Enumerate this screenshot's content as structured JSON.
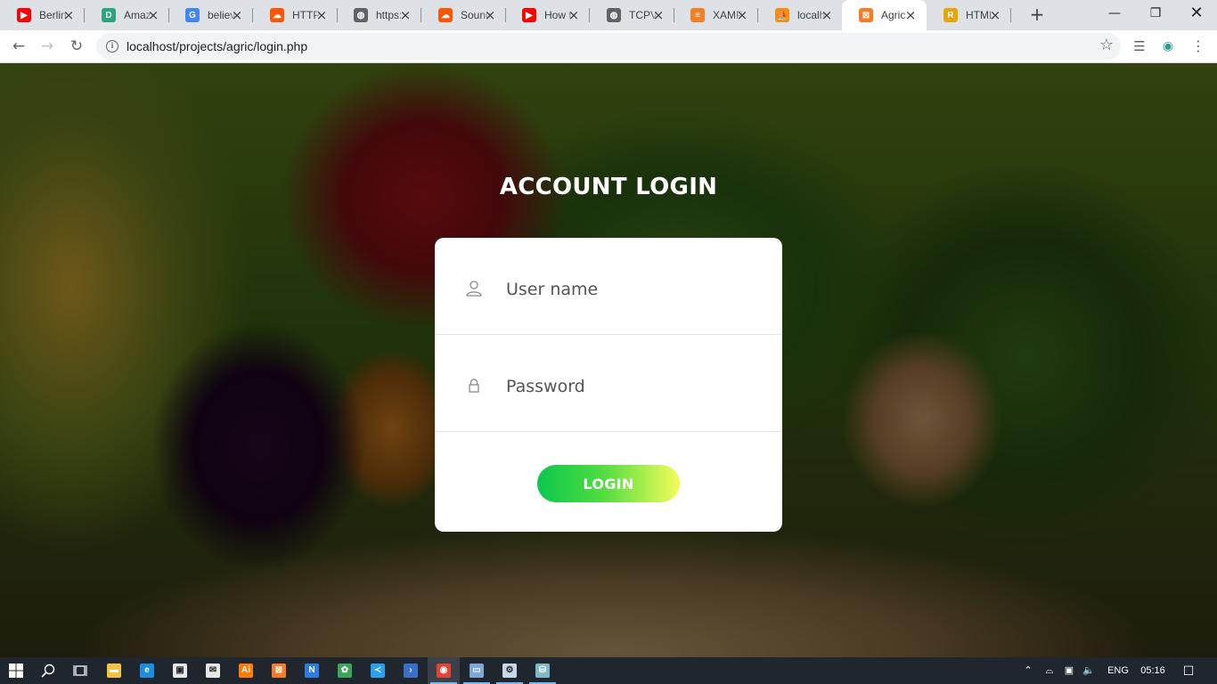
{
  "browser": {
    "tabs": [
      {
        "title": "Berlin",
        "icon": "youtube-icon",
        "color": "#ff0000",
        "glyph": "▶"
      },
      {
        "title": "Amazon",
        "icon": "d-letter-icon",
        "color": "#2aa67a",
        "glyph": "D"
      },
      {
        "title": "believe",
        "icon": "google-icon",
        "color": "#4285f4",
        "glyph": "G"
      },
      {
        "title": "HTTP",
        "icon": "soundcloud-icon",
        "color": "#ff5500",
        "glyph": "☁"
      },
      {
        "title": "https:",
        "icon": "globe-icon",
        "color": "#5f6368",
        "glyph": "◍"
      },
      {
        "title": "Sound",
        "icon": "soundcloud-icon",
        "color": "#ff5500",
        "glyph": "☁"
      },
      {
        "title": "How t",
        "icon": "youtube-icon",
        "color": "#ff0000",
        "glyph": "▶"
      },
      {
        "title": "TCPVi",
        "icon": "globe-icon",
        "color": "#5f6368",
        "glyph": "◍"
      },
      {
        "title": "XAMP",
        "icon": "stackoverflow-icon",
        "color": "#f48024",
        "glyph": "≡"
      },
      {
        "title": "localh",
        "icon": "phpmyadmin-icon",
        "color": "#f29111",
        "glyph": "⛵"
      },
      {
        "title": "Agric",
        "icon": "xampp-icon",
        "color": "#fb7a24",
        "glyph": "⊠",
        "active": true
      },
      {
        "title": "HTML",
        "icon": "r-letter-icon",
        "color": "#e8a400",
        "glyph": "R"
      }
    ],
    "address": "localhost/projects/agric/login.php"
  },
  "page": {
    "heading": "ACCOUNT LOGIN",
    "username_placeholder": "User name",
    "password_placeholder": "Password",
    "login_label": "LOGIN"
  },
  "colors": {
    "button_gradient_start": "#0bc74e",
    "button_gradient_end": "#f4fd5a",
    "taskbar": "#20262e"
  },
  "taskbar": {
    "apps": [
      {
        "name": "file-explorer-icon",
        "color": "#f5c23e",
        "glyph": "▬"
      },
      {
        "name": "edge-icon",
        "color": "#1a8ee0",
        "glyph": "e"
      },
      {
        "name": "store-icon",
        "color": "#e8e8e8",
        "glyph": "▣"
      },
      {
        "name": "mail-icon",
        "color": "#e8e8e8",
        "glyph": "✉"
      },
      {
        "name": "illustrator-icon",
        "color": "#ff7c00",
        "glyph": "Ai"
      },
      {
        "name": "xampp-icon",
        "color": "#fb7a24",
        "glyph": "⊠"
      },
      {
        "name": "notepad-icon",
        "color": "#2d7de0",
        "glyph": "N"
      },
      {
        "name": "network-icon",
        "color": "#3aa65a",
        "glyph": "✿"
      },
      {
        "name": "vscode-icon",
        "color": "#2aa0f0",
        "glyph": "≺"
      },
      {
        "name": "powershell-icon",
        "color": "#3a70c8",
        "glyph": "›"
      },
      {
        "name": "chrome-icon",
        "color": "#e24335",
        "glyph": "◉",
        "active": true
      },
      {
        "name": "remote-desktop-icon",
        "color": "#7fa8d8",
        "glyph": "▭",
        "open": true
      },
      {
        "name": "settings-gear-icon",
        "color": "#c9d8e8",
        "glyph": "⚙",
        "open": true
      },
      {
        "name": "uploader-icon",
        "color": "#7fb8c8",
        "glyph": "⛁",
        "open": true
      }
    ],
    "language": "ENG",
    "time": "05:16"
  }
}
